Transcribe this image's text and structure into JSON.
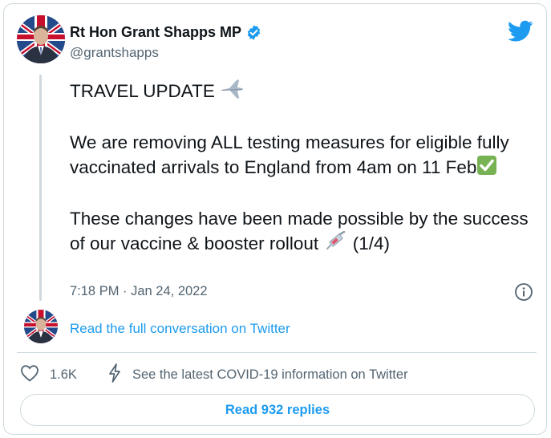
{
  "author": {
    "display_name": "Rt Hon Grant Shapps MP",
    "handle": "@grantshapps",
    "verified": true,
    "avatar_icon": "profile-photo-with-union-flag"
  },
  "brand": {
    "icon": "twitter-bird-icon",
    "color": "#1d9bf0"
  },
  "tweet": {
    "line1": "TRAVEL UPDATE",
    "line1_emoji": "airplane",
    "para2": "We are removing ALL testing measures for eligible fully vaccinated arrivals to England from 4am on 11 Feb",
    "para2_emoji": "check-mark-button",
    "para3": "These changes have been made possible by the success of our vaccine & booster rollout",
    "para3_emoji": "syringe",
    "para3_suffix": "(1/4)",
    "timestamp": "7:18 PM · Jan 24, 2022"
  },
  "conversation": {
    "link_label": "Read the full conversation on Twitter"
  },
  "actions": {
    "like_count": "1.6K",
    "covid_label": "See the latest COVID-19 information on Twitter"
  },
  "replies": {
    "label": "Read 932 replies"
  },
  "colors": {
    "accent": "#1d9bf0",
    "text_primary": "#0f1419",
    "text_secondary": "#536471",
    "border": "#cfd9de",
    "check_green": "#77b255"
  }
}
